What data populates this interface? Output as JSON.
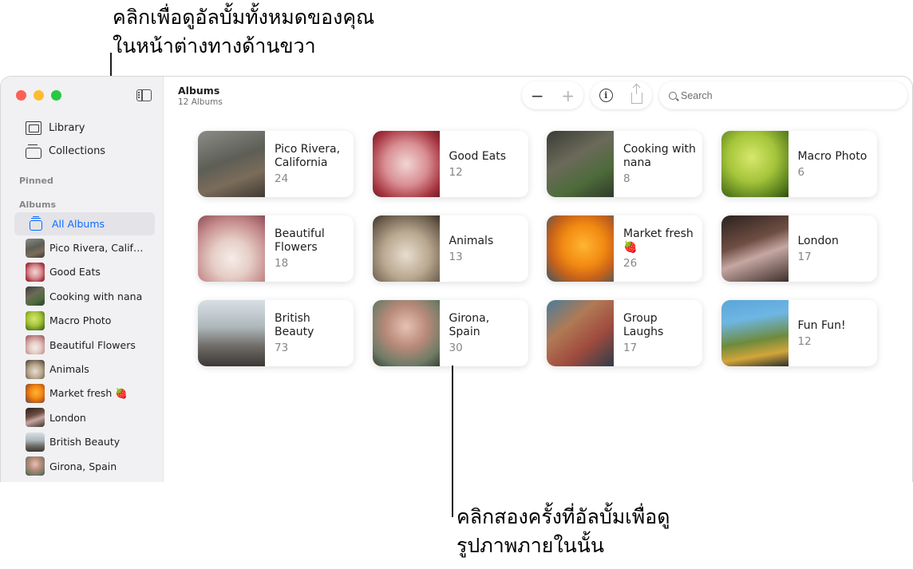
{
  "callouts": {
    "top": [
      "คลิกเพื่อดูอัลบั้มทั้งหมดของคุณ",
      "ในหน้าต่างทางด้านขวา"
    ],
    "bottom": [
      "คลิกสองครั้งที่อัลบั้มเพื่อดู",
      "รูปภาพภายในนั้น"
    ]
  },
  "sidebar": {
    "nav": [
      {
        "label": "Library",
        "icon": "photo-library-icon"
      },
      {
        "label": "Collections",
        "icon": "collections-icon"
      }
    ],
    "pinned_label": "Pinned",
    "albums_label": "Albums",
    "all_albums_label": "All Albums",
    "albums": [
      "Pico Rivera, Califor...",
      "Good Eats",
      "Cooking with nana",
      "Macro Photo",
      "Beautiful Flowers",
      "Animals",
      "Market fresh 🍓",
      "London",
      "British Beauty",
      "Girona, Spain"
    ]
  },
  "toolbar": {
    "title": "Albums",
    "subtitle": "12 Albums",
    "zoom_out": "−",
    "zoom_in": "+",
    "info": "i"
  },
  "search": {
    "placeholder": "Search"
  },
  "albums": [
    {
      "name": "Pico Rivera, California",
      "count": "24",
      "photo": "p-pico"
    },
    {
      "name": "Good Eats",
      "count": "12",
      "photo": "p-good"
    },
    {
      "name": "Cooking with nana",
      "count": "8",
      "photo": "p-cook"
    },
    {
      "name": "Macro Photo",
      "count": "6",
      "photo": "p-macro"
    },
    {
      "name": "Beautiful Flowers",
      "count": "18",
      "photo": "p-flowers"
    },
    {
      "name": "Animals",
      "count": "13",
      "photo": "p-animals"
    },
    {
      "name": "Market fresh 🍓",
      "count": "26",
      "photo": "p-market"
    },
    {
      "name": "London",
      "count": "17",
      "photo": "p-london"
    },
    {
      "name": "British Beauty",
      "count": "73",
      "photo": "p-british"
    },
    {
      "name": "Girona, Spain",
      "count": "30",
      "photo": "p-girona"
    },
    {
      "name": "Group Laughs",
      "count": "17",
      "photo": "p-group"
    },
    {
      "name": "Fun Fun!",
      "count": "12",
      "photo": "p-fun"
    }
  ],
  "colors": {
    "accent": "#0a6cff",
    "close": "#fe5f57",
    "minimize": "#febc2e",
    "zoom": "#28c840"
  }
}
